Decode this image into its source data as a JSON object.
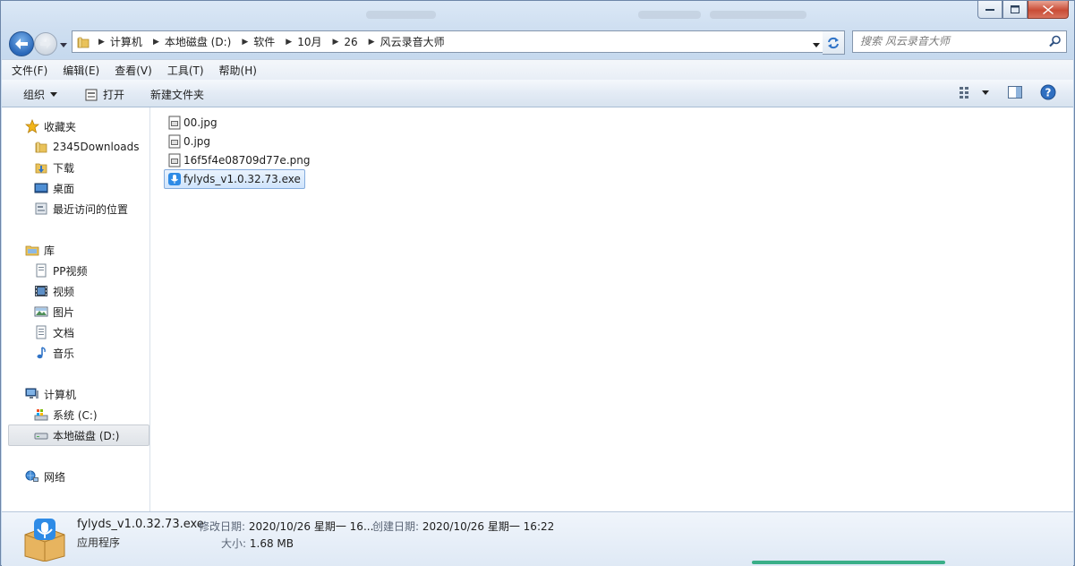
{
  "window": {
    "blurred_titles": [
      "",
      "",
      ""
    ]
  },
  "nav": {
    "breadcrumbs": [
      "计算机",
      "本地磁盘 (D:)",
      "软件",
      "10月",
      "26",
      "风云录音大师"
    ],
    "search_placeholder": "搜索 风云录音大师"
  },
  "menubar": {
    "items": [
      "文件(F)",
      "编辑(E)",
      "查看(V)",
      "工具(T)",
      "帮助(H)"
    ]
  },
  "toolbar": {
    "organize": "组织",
    "open": "打开",
    "new_folder": "新建文件夹"
  },
  "sidebar": {
    "favorites_header": "收藏夹",
    "favorites": [
      "2345Downloads",
      "下载",
      "桌面",
      "最近访问的位置"
    ],
    "libraries_header": "库",
    "libraries": [
      "PP视频",
      "视频",
      "图片",
      "文档",
      "音乐"
    ],
    "computer_header": "计算机",
    "drives": [
      "系统 (C:)",
      "本地磁盘 (D:)"
    ],
    "network_header": "网络"
  },
  "files": [
    {
      "name": "00.jpg",
      "icon": "image-file-icon"
    },
    {
      "name": "0.jpg",
      "icon": "image-file-icon"
    },
    {
      "name": "16f5f4e08709d77e.png",
      "icon": "image-file-icon"
    },
    {
      "name": "fylyds_v1.0.32.73.exe",
      "icon": "microphone-app-icon",
      "selected": true
    }
  ],
  "details": {
    "name": "fylyds_v1.0.32.73.exe",
    "type": "应用程序",
    "modified_label": "修改日期:",
    "modified_value": "2020/10/26 星期一 16...",
    "created_label": "创建日期:",
    "created_value": "2020/10/26 星期一 16:22",
    "size_label": "大小:",
    "size_value": "1.68 MB"
  }
}
